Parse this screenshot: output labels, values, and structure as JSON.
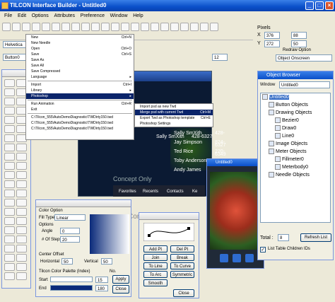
{
  "app": {
    "title": "TILCON Interface Builder - Untitled0",
    "min": "_",
    "max": "□",
    "close": "×"
  },
  "menu": [
    "File",
    "Edit",
    "Options",
    "Attributes",
    "Preference",
    "Window",
    "Help"
  ],
  "font": {
    "name": "Helvetica",
    "size": "12",
    "object": "Button0"
  },
  "pixels": {
    "label": "Pixels",
    "x_label": "X",
    "x": "376",
    "dx": "88",
    "y_label": "Y",
    "y": "272",
    "dy": "50",
    "redraw_label": "Redraw Option",
    "redraw_value": "Object Onscreen"
  },
  "file_menu": {
    "items": [
      {
        "label": "New",
        "shortcut": "Ctrl+N"
      },
      {
        "label": "New Needle",
        "shortcut": ""
      },
      {
        "label": "Open",
        "shortcut": "Ctrl+O"
      },
      {
        "label": "Save",
        "shortcut": "Ctrl+S"
      },
      {
        "label": "Save As",
        "shortcut": ""
      },
      {
        "label": "Save All",
        "shortcut": ""
      },
      {
        "label": "Save Compressed",
        "shortcut": ""
      },
      {
        "label": "Language",
        "shortcut": "▸"
      },
      {
        "label": "Import",
        "shortcut": "Ctrl+I"
      },
      {
        "label": "Library",
        "shortcut": "▸"
      },
      {
        "label": "Photoshop",
        "shortcut": "▸"
      },
      {
        "label": "Run Animation",
        "shortcut": "Ctrl+R"
      },
      {
        "label": "Exit",
        "shortcut": ""
      },
      {
        "label": "C:\\Tilcon_555\\AutoDemoDiagnostic\\TWDirty150.twd",
        "shortcut": ""
      },
      {
        "label": "C:\\Tilcon_555\\AutoDemoDiagnostic\\TWDirty150.twd",
        "shortcut": ""
      },
      {
        "label": "C:\\Tilcon_555\\AutoDemoDiagnostic\\TWDirty150.twd",
        "shortcut": ""
      }
    ],
    "submenu": [
      {
        "label": "Import psd as new Twd",
        "shortcut": ""
      },
      {
        "label": "Merge psd with current Twd",
        "shortcut": "Ctrl+M"
      },
      {
        "label": "Export Twd as Photoshop template",
        "shortcut": "Ctrl+E"
      },
      {
        "label": "Photoshop Settings",
        "shortcut": ""
      }
    ]
  },
  "phone": {
    "contacts": [
      {
        "name": "Sally SmXith",
        "number": "428-6327"
      },
      {
        "name": "Jay Simpson",
        "number": "824-6349"
      },
      {
        "name": "Ted Rice",
        "number": "220-4326"
      },
      {
        "name": "Toby Anderson",
        "number": ""
      },
      {
        "name": "Andy James",
        "number": ""
      }
    ],
    "watermark": "Concept Only",
    "tabs": [
      "Favorites",
      "Recents",
      "Contacts",
      "Ke"
    ]
  },
  "object_browser": {
    "title": "Object Browser",
    "window_label": "Window",
    "window_value": "Untitled0",
    "tree": [
      "Untitled0",
      "Button Objects",
      "Drawing Objects",
      "Bezier0",
      "Draw0",
      "Line0",
      "Image Objects",
      "Meter Objects",
      "Fillmeter0",
      "Meterbody0",
      "Needle Objects"
    ],
    "total_label": "Total :",
    "total": "8",
    "refresh": "Refresh List",
    "checkbox": "List Table Children IDs"
  },
  "untitled_window": {
    "title": "Untitled0"
  },
  "color_option": {
    "title": "Color Option",
    "fill_type_label": "Fill Type",
    "fill_type": "Linear",
    "options_label": "Options",
    "angle_label": "Angle",
    "angle": "0",
    "num_steps_label": "# Of Steps",
    "num_steps": "20",
    "center_label": "Center Offset",
    "horizontal_label": "Horizontal",
    "horizontal": "50",
    "vertical_label": "Vertical",
    "vertical": "50",
    "palette_label": "Tilcon Color Palette (Index)",
    "no_label": "No.",
    "start_label": "Start",
    "start": "15",
    "end_label": "End",
    "end": "180",
    "apply": "Apply",
    "close": "Close"
  },
  "draw_tools": {
    "buttons": [
      "Add Pt",
      "Del Pt",
      "Join",
      "Break",
      "To Line",
      "To Curve",
      "To Arc",
      "Symmetric",
      "Smooth"
    ],
    "close": "Close"
  },
  "colors": {
    "xp_blue": "#0a4fc9",
    "menu_highlight": "#0a246a",
    "phone_dark": "#0b1a33"
  }
}
